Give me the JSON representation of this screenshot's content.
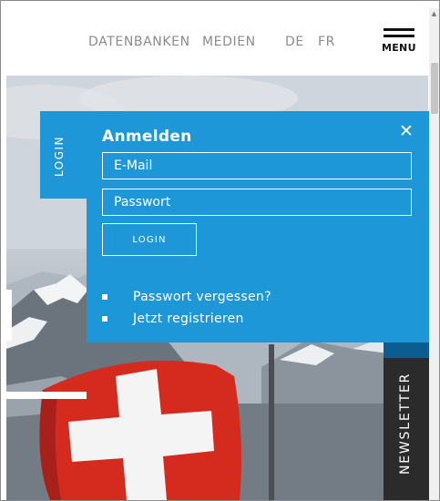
{
  "header": {
    "nav": [
      "DATENBANKEN",
      "MEDIEN"
    ],
    "languages": [
      "DE",
      "FR"
    ],
    "menu_label": "MENU"
  },
  "login_tab": {
    "label": "LOGIN"
  },
  "login_panel": {
    "title": "Anmelden",
    "close_icon": "close-icon",
    "email_placeholder": "E-Mail",
    "password_placeholder": "Passwort",
    "login_button": "LOGIN",
    "links": [
      "Passwort vergessen?",
      "Jetzt registrieren"
    ]
  },
  "newsletter_tab": {
    "label": "NEWSLETTER"
  },
  "colors": {
    "panel_blue": "#1e97d8",
    "dark_blue": "#0c5d8f",
    "newsletter_bg": "#2b2b2b",
    "flag_red": "#d52b1e"
  }
}
